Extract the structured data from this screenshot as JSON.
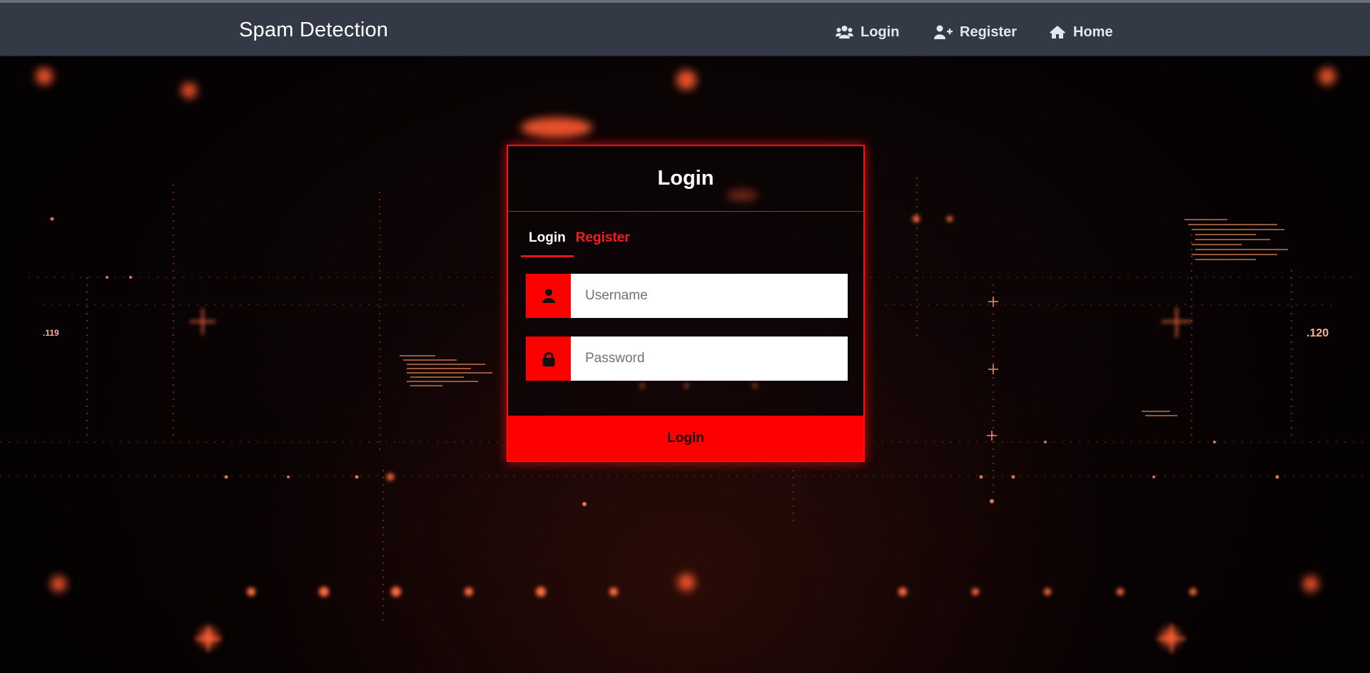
{
  "navbar": {
    "brand": "Spam Detection",
    "items": [
      {
        "label": "Login",
        "icon": "users-icon"
      },
      {
        "label": "Register",
        "icon": "user-plus-icon"
      },
      {
        "label": "Home",
        "icon": "home-icon"
      }
    ]
  },
  "background": {
    "labels": [
      ".119",
      ".120"
    ]
  },
  "login_card": {
    "title": "Login",
    "tabs": [
      {
        "label": "Login",
        "active": true
      },
      {
        "label": "Register",
        "active": false
      }
    ],
    "username": {
      "placeholder": "Username",
      "value": "",
      "icon": "user-icon"
    },
    "password": {
      "placeholder": "Password",
      "value": "",
      "icon": "lock-icon"
    },
    "submit_label": "Login"
  },
  "colors": {
    "navbar_bg": "#333a45",
    "accent": "#ff0000",
    "tab_inactive": "#ff1a1a",
    "background": "#050203"
  }
}
